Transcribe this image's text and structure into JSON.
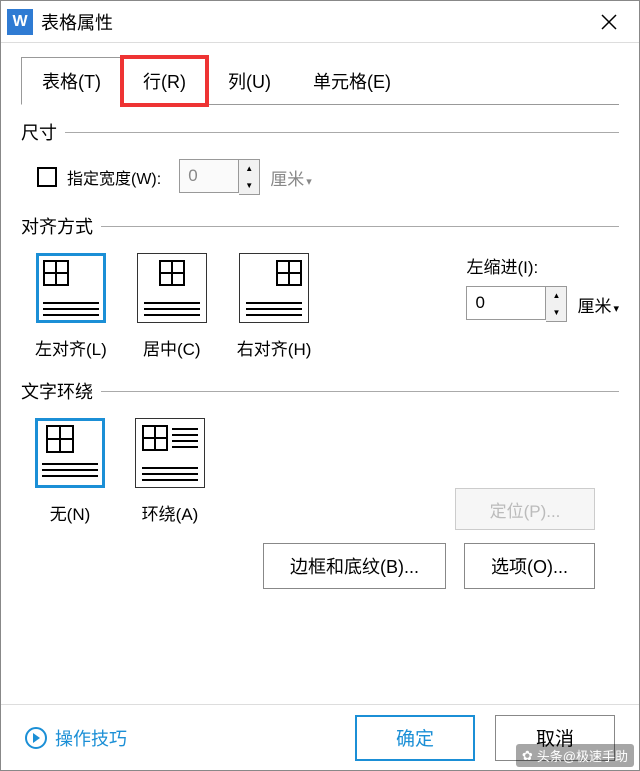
{
  "window": {
    "app_icon_letter": "W",
    "title": "表格属性"
  },
  "tabs": {
    "items": [
      {
        "label": "表格(T)"
      },
      {
        "label": "行(R)"
      },
      {
        "label": "列(U)"
      },
      {
        "label": "单元格(E)"
      }
    ],
    "active_index": 0,
    "highlight_index": 1
  },
  "size_section": {
    "title": "尺寸",
    "specify_width_label": "指定宽度(W):",
    "width_value": "0",
    "width_unit": "厘米"
  },
  "align_section": {
    "title": "对齐方式",
    "items": [
      {
        "label": "左对齐(L)"
      },
      {
        "label": "居中(C)"
      },
      {
        "label": "右对齐(H)"
      }
    ],
    "selected_index": 0,
    "indent_label": "左缩进(I):",
    "indent_value": "0",
    "indent_unit": "厘米"
  },
  "wrap_section": {
    "title": "文字环绕",
    "items": [
      {
        "label": "无(N)"
      },
      {
        "label": "环绕(A)"
      }
    ],
    "selected_index": 0,
    "position_button": "定位(P)..."
  },
  "bottom_buttons": {
    "border_shading": "边框和底纹(B)...",
    "options": "选项(O)..."
  },
  "footer": {
    "tips": "操作技巧",
    "ok": "确定",
    "cancel": "取消"
  },
  "watermark": "头条@极速手助"
}
